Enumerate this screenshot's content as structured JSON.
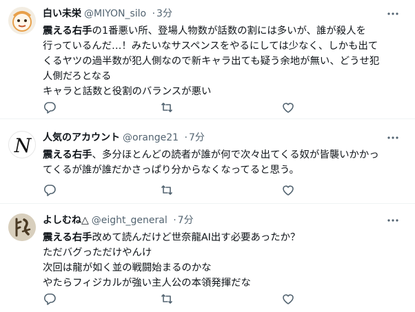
{
  "tweets": [
    {
      "name": "白い未栄",
      "handle": "@MIYON_silo",
      "sep": "·",
      "time": "3分",
      "mention": "震える右手",
      "lines": [
        "の1番悪い所、登場人物数が話数の割には多いが、誰が殺人を",
        "行っているんだ…！みたいなサスペンスをやるにしては少なく、しかも出て",
        "くるヤツの過半数が犯人側なので新キャラ出ても疑う余地が無い、どうせ犯",
        "人側だろとなる",
        "キャラと話数と役割のバランスが悪い"
      ],
      "avatar": {
        "bg": "#f3ede2",
        "accent": "#e8a04a"
      }
    },
    {
      "name": "人気のアカウント",
      "handle": "@orange21",
      "sep": "·",
      "time": "7分",
      "mention": "震える右手",
      "lines": [
        "、多分ほとんどの読者が誰が何で次々出てくる奴が皆襲いかかっ",
        "てくるが誰が誰だかさっぱり分からなくなってると思う。"
      ],
      "avatar": {
        "bg": "#ffffff",
        "letter": "N"
      }
    },
    {
      "name": "よしむね△",
      "handle": "@eight_general",
      "sep": "·",
      "time": "7分",
      "mention": "震える右手",
      "lines": [
        "改めて読んだけど世奈龍AI出す必要あったか？",
        "ただバグっただけやんけ",
        "次回は龍が如く並の戦闘始まるのかな",
        "やたらフィジカルが強い主人公の本領発揮だな"
      ],
      "avatar": {
        "bg": "#d8cfbd",
        "ink": "#4a3a24"
      }
    }
  ],
  "icons": [
    "more-icon",
    "reply-icon",
    "retweet-icon",
    "like-icon",
    "share-icon"
  ],
  "colors": {
    "text": "#0f1419",
    "muted": "#536471",
    "divider": "#eff3f4"
  }
}
